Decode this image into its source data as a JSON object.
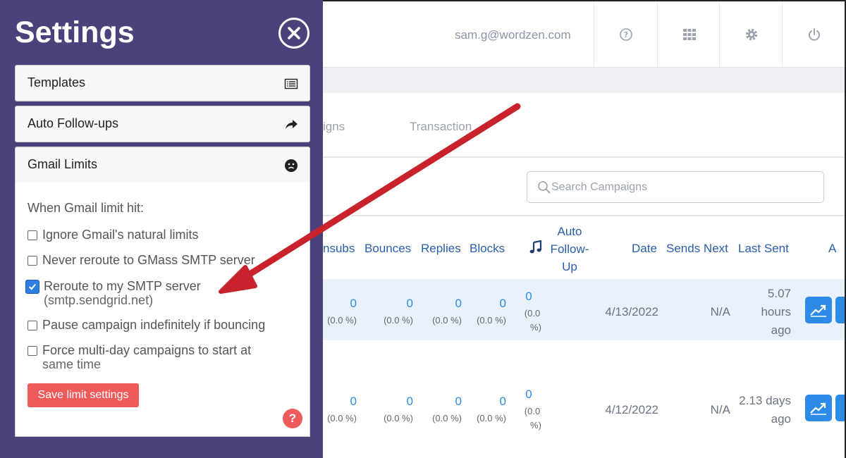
{
  "header": {
    "email": "sam.g@wordzen.com",
    "icons": [
      "help-icon",
      "apps-grid-icon",
      "gear-icon",
      "power-icon"
    ]
  },
  "tabs": [
    "igns",
    "Transaction"
  ],
  "search": {
    "placeholder": "Search Campaigns"
  },
  "table": {
    "headers": {
      "unsubs": "nsubs",
      "bounces": "Bounces",
      "replies": "Replies",
      "blocks": "Blocks",
      "auto_line1": "Auto",
      "auto_line2": "Follow-",
      "auto_line3": "Up",
      "date": "Date",
      "sends_next": "Sends Next",
      "last_sent": "Last Sent",
      "actions": "A"
    },
    "rows": [
      {
        "unsubs": "0",
        "unsubs_pct": "(0.0 %)",
        "bounces": "0",
        "bounces_pct": "(0.0 %)",
        "replies": "0",
        "replies_pct": "(0.0 %)",
        "blocks": "0",
        "blocks_pct": "(0.0 %)",
        "auto": "0",
        "auto_pct_1": "(0.0",
        "auto_pct_2": "%)",
        "date": "4/13/2022",
        "sends_next": "N/A",
        "last_sent_1": "5.07",
        "last_sent_2": "hours",
        "last_sent_3": "ago"
      },
      {
        "unsubs": "0",
        "unsubs_pct": "(0.0 %)",
        "bounces": "0",
        "bounces_pct": "(0.0 %)",
        "replies": "0",
        "replies_pct": "(0.0 %)",
        "blocks": "0",
        "blocks_pct": "(0.0 %)",
        "auto": "0",
        "auto_pct_1": "(0.0",
        "auto_pct_2": "%)",
        "date": "4/12/2022",
        "sends_next": "N/A",
        "last_sent_1": "2.13 days",
        "last_sent_2": "ago"
      }
    ]
  },
  "settings": {
    "title": "Settings",
    "sections": {
      "templates": "Templates",
      "auto_followups": "Auto Follow-ups",
      "gmail_limits": "Gmail Limits"
    },
    "when_label": "When Gmail limit hit:",
    "options": [
      {
        "label": "Ignore Gmail's natural limits",
        "checked": false
      },
      {
        "label": "Never reroute to GMass SMTP server",
        "checked": false
      },
      {
        "label": "Reroute to my SMTP server",
        "sub": "(smtp.sendgrid.net)",
        "checked": true
      },
      {
        "label": "Pause campaign indefinitely if bouncing",
        "checked": false
      },
      {
        "label": "Force multi-day campaigns to start at",
        "sub": "same time",
        "checked": false
      }
    ],
    "save_label": "Save limit settings",
    "help_label": "?"
  },
  "colors": {
    "settings_bg": "#4d417c",
    "accent_blue": "#2d8ae6",
    "save_red": "#ef5b5b",
    "arrow_red": "#c8232c"
  }
}
